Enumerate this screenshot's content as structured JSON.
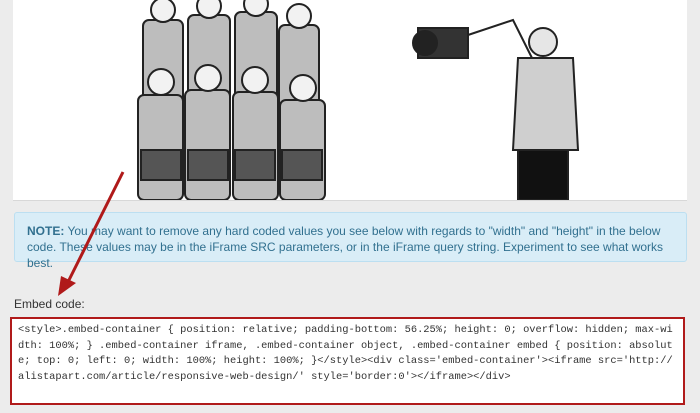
{
  "note": {
    "label": "NOTE:",
    "text": " You may want to remove any hard coded values you see below with regards to \"width\" and \"height\" in the below code. These values may be in the iFrame SRC parameters, or in the iFrame query string. Experiment to see what works best."
  },
  "embed": {
    "label": "Embed code:",
    "code": "<style>.embed-container { position: relative; padding-bottom: 56.25%; height: 0; overflow: hidden; max-width: 100%; } .embed-container iframe, .embed-container object, .embed-container embed { position: absolute; top: 0; left: 0; width: 100%; height: 100%; }</style><div class='embed-container'><iframe src='http://alistapart.com/article/responsive-web-design/' style='border:0'></iframe></div>"
  },
  "colors": {
    "note_background": "#d9edf7",
    "note_text": "#31708f",
    "highlight_red": "#b01a1a"
  }
}
